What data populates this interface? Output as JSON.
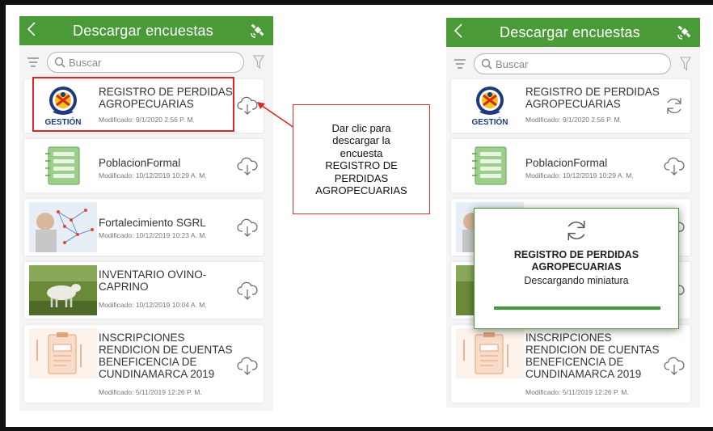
{
  "screen": {
    "title": "Descargar encuestas",
    "search_placeholder": "Buscar",
    "accent": "#4a9b38",
    "back_icon": "chevron-left-icon",
    "download_icon": "cloud-download-icon",
    "refresh_icon": "refresh-icon"
  },
  "left_items": [
    {
      "title": "REGISTRO DE PERDIDAS AGROPECUARIAS",
      "modified": "Modificado: 9/1/2020 2:56 P. M.",
      "logo_text": "GESTIÓN"
    },
    {
      "title": "PoblacionFormal",
      "modified": "Modificado: 10/12/2019 10:29 A. M."
    },
    {
      "title": "Fortalecimiento SGRL",
      "modified": "Modificado: 10/12/2019 10:23 A. M."
    },
    {
      "title": "INVENTARIO OVINO-CAPRINO",
      "modified": "Modificado: 10/12/2019 10:04 A. M."
    },
    {
      "title": "INSCRIPCIONES RENDICION DE CUENTAS BENEFICENCIA DE CUNDINAMARCA  2019",
      "modified": "Modificado: 5/11/2019 12:26 P. M."
    }
  ],
  "right_items": [
    {
      "title": "REGISTRO DE PERDIDAS AGROPECUARIAS",
      "modified": "Modificado: 9/1/2020 2:56 P. M.",
      "logo_text": "GESTIÓN"
    },
    {
      "title": "PoblacionFormal",
      "modified": "Modificado: 10/12/2019 10:29 A. M."
    },
    {
      "title": "INSCRIPCIONES RENDICION DE CUENTAS BENEFICENCIA DE CUNDINAMARCA  2019",
      "modified": "Modificado: 5/11/2019 12:26 P. M."
    }
  ],
  "callout": {
    "line1": "Dar clic para",
    "line2": "descargar la",
    "line3": "encuesta",
    "line4": "REGISTRO DE",
    "line5": "PERDIDAS",
    "line6": "AGROPECUARIAS"
  },
  "dialog": {
    "title_line1": "REGISTRO DE PERDIDAS",
    "title_line2": "AGROPECUARIAS",
    "status": "Descargando miniatura",
    "progress": 1.0
  }
}
